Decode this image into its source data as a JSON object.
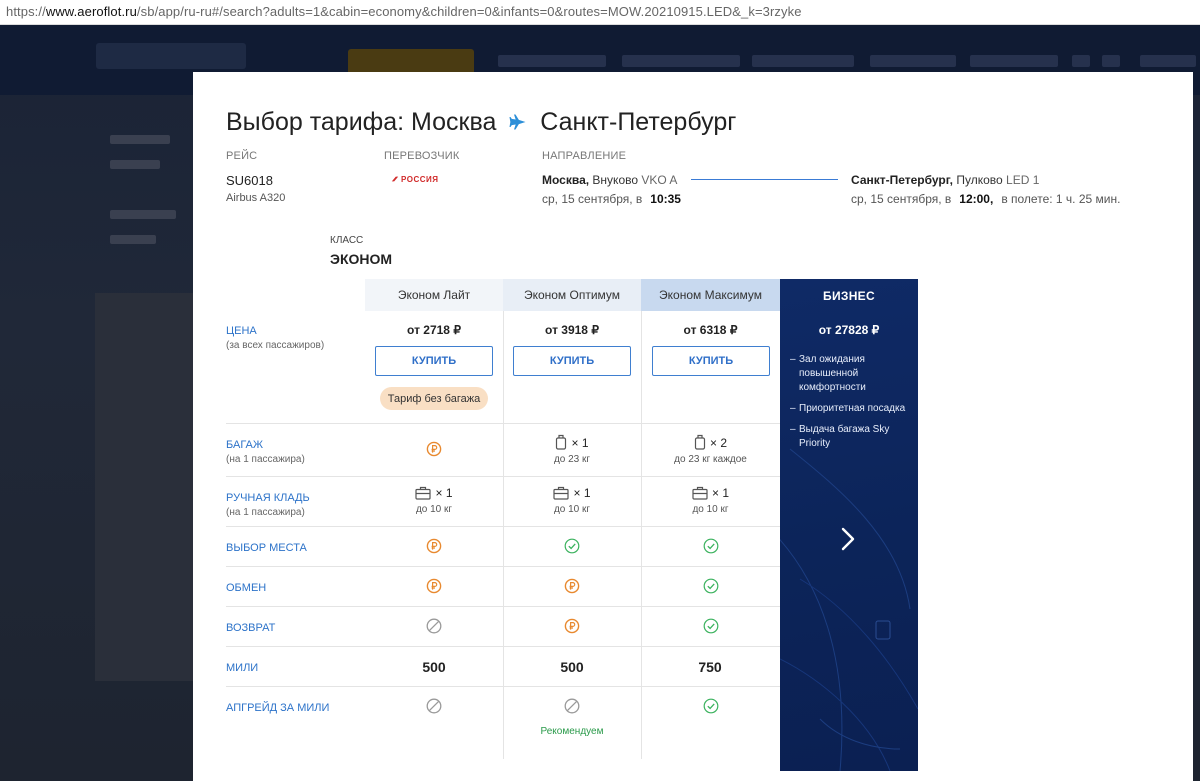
{
  "browser": {
    "url_prefix": "https://",
    "url_domain": "www.aeroflot.ru",
    "url_rest": "/sb/app/ru-ru#/search?adults=1&cabin=economy&children=0&infants=0&routes=MOW.20210915.LED&_k=3rzyke"
  },
  "modal": {
    "title_prefix": "Выбор тарифа: Москва",
    "title_dest": "Санкт-Петербург",
    "labels": {
      "flight": "РЕЙС",
      "carrier": "ПЕРЕВОЗЧИК",
      "direction": "НАПРАВЛЕНИЕ"
    },
    "flight": {
      "number": "SU6018",
      "aircraft": "Airbus A320",
      "carrier_name": "РОССИЯ"
    },
    "departure": {
      "city": "Москва,",
      "airport": "Внуково",
      "code": "VKO A",
      "date": "ср, 15 сентября, в",
      "time": "10:35"
    },
    "arrival": {
      "city": "Санкт-Петербург,",
      "airport": "Пулково",
      "code": "LED 1",
      "date": "ср, 15 сентября, в",
      "time": "12:00,",
      "duration": "в полете: 1 ч. 25 мин."
    },
    "cabin_class_label": "КЛАСС",
    "cabin_class": "ЭКОНОМ"
  },
  "fares": {
    "headers": [
      "Эконом Лайт",
      "Эконом Оптимум",
      "Эконом Максимум"
    ],
    "rows": {
      "price": {
        "label": "ЦЕНА",
        "sub": "(за всех пассажиров)"
      },
      "baggage": {
        "label": "БАГАЖ",
        "sub": "(на 1 пассажира)"
      },
      "hand": {
        "label": "РУЧНАЯ КЛАДЬ",
        "sub": "(на 1 пассажира)"
      },
      "seat": {
        "label": "ВЫБОР МЕСТА"
      },
      "exchange": {
        "label": "ОБМЕН"
      },
      "refund": {
        "label": "ВОЗВРАТ"
      },
      "miles": {
        "label": "МИЛИ"
      },
      "upgrade": {
        "label": "АПГРЕЙД ЗА МИЛИ"
      }
    },
    "prices": [
      "от 2718 ₽",
      "от 3918 ₽",
      "от 6318 ₽"
    ],
    "buy_label": "КУПИТЬ",
    "no_baggage_badge": "Тариф без багажа",
    "baggage": [
      {
        "type": "paid"
      },
      {
        "count": "× 1",
        "note": "до 23 кг"
      },
      {
        "count": "× 2",
        "note": "до 23 кг каждое"
      }
    ],
    "hand_luggage": [
      {
        "count": "× 1",
        "note": "до 10 кг"
      },
      {
        "count": "× 1",
        "note": "до 10 кг"
      },
      {
        "count": "× 1",
        "note": "до 10 кг"
      }
    ],
    "seat_selection": [
      "paid",
      "included",
      "included"
    ],
    "exchange": [
      "paid",
      "paid",
      "included"
    ],
    "refund": [
      "unavailable",
      "paid",
      "included"
    ],
    "miles": [
      "500",
      "500",
      "750"
    ],
    "upgrade": [
      "unavailable",
      "unavailable",
      "included"
    ],
    "recommended": "Рекомендуем",
    "business": {
      "title": "БИЗНЕС",
      "price": "от 27828 ₽",
      "features": [
        "Зал ожидания повышенной комфортности",
        "Приоритетная посадка",
        "Выдача багажа Sky Priority"
      ]
    }
  },
  "colors": {
    "accent_blue": "#2d73c9",
    "paid_orange": "#e8892f",
    "included_green": "#3bb25e",
    "unavailable_gray": "#9a9a9a",
    "business_bg": "#0c2459",
    "badge_bg": "#f9dfc4"
  },
  "icons": {
    "paid": "ruble-circle-icon",
    "included": "check-circle-icon",
    "unavailable": "prohibited-icon",
    "baggage": "suitcase-icon",
    "hand": "briefcase-icon"
  }
}
